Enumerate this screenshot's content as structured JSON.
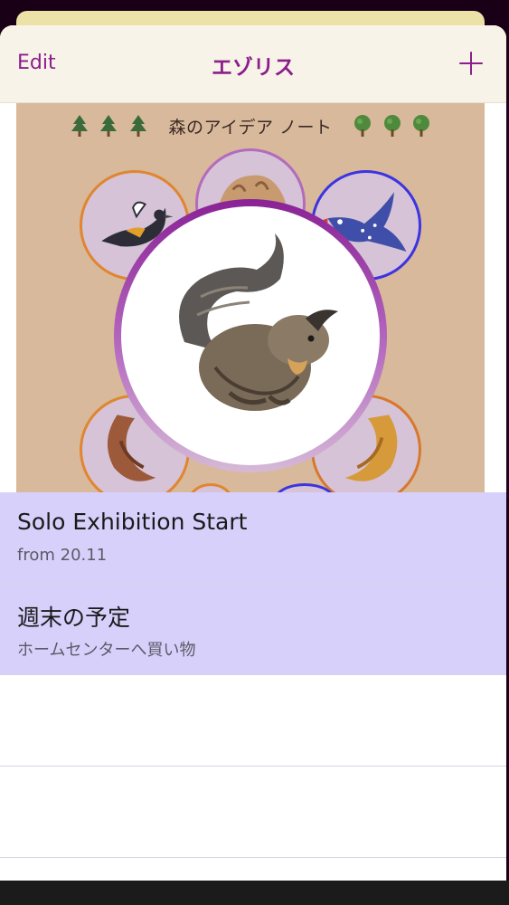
{
  "nav": {
    "edit_label": "Edit",
    "title": "エゾリス",
    "add_icon": "plus-icon"
  },
  "hero": {
    "heading": "森のアイデア ノート",
    "left_icons": [
      "conifer-tree-icon",
      "conifer-tree-icon",
      "conifer-tree-icon"
    ],
    "right_icons": [
      "round-tree-icon",
      "round-tree-icon",
      "round-tree-icon"
    ],
    "main_image": "squirrel-illustration"
  },
  "list": {
    "items": [
      {
        "title": "Solo Exhibition Start",
        "subtitle": "from 20.11"
      },
      {
        "title": "週末の予定",
        "subtitle": "ホームセンターへ買い物"
      }
    ]
  },
  "colors": {
    "accent": "#8b1e8b",
    "hero_background": "#d8b99c",
    "row_fill": "#d7d0fb",
    "navbar": "#f8f3e8"
  }
}
